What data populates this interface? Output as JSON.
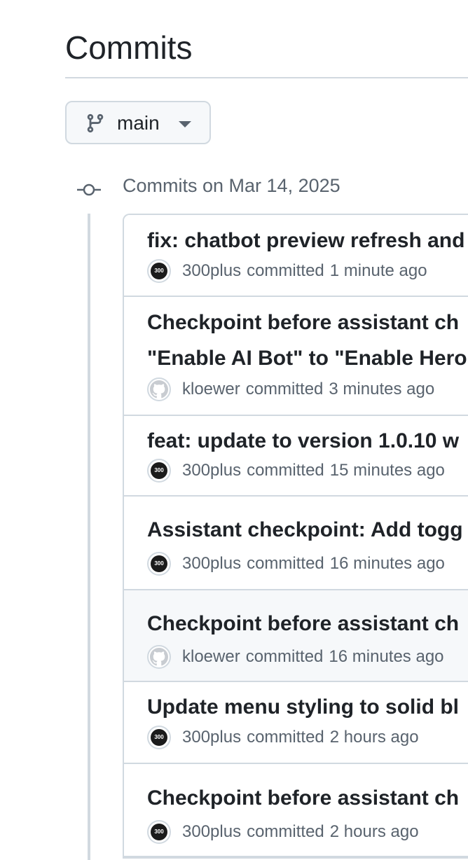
{
  "page": {
    "title": "Commits"
  },
  "branch": {
    "label": "main"
  },
  "group": {
    "date_label": "Commits on Mar 14, 2025"
  },
  "commits": [
    {
      "title": "fix: chatbot preview refresh and",
      "author": "300plus",
      "action": "committed",
      "time": "1 minute ago",
      "avatar": "300"
    },
    {
      "title": "Checkpoint before assistant ch",
      "title_line2": "\"Enable AI Bot\" to \"Enable Hero",
      "author": "kloewer",
      "action": "committed",
      "time": "3 minutes ago",
      "avatar": "github"
    },
    {
      "title": "feat: update to version 1.0.10 w",
      "author": "300plus",
      "action": "committed",
      "time": "15 minutes ago",
      "avatar": "300"
    },
    {
      "title": "Assistant checkpoint: Add togg",
      "author": "300plus",
      "action": "committed",
      "time": "16 minutes ago",
      "avatar": "300"
    },
    {
      "title": "Checkpoint before assistant ch",
      "author": "kloewer",
      "action": "committed",
      "time": "16 minutes ago",
      "avatar": "github"
    },
    {
      "title": "Update menu styling to solid bl",
      "author": "300plus",
      "action": "committed",
      "time": "2 hours ago",
      "avatar": "300"
    },
    {
      "title": "Checkpoint before assistant ch",
      "author": "300plus",
      "action": "committed",
      "time": "2 hours ago",
      "avatar": "300"
    }
  ],
  "avatar_text": "300",
  "icons": {
    "branch": "git-branch-icon",
    "caret": "caret-down-icon",
    "commit_node": "git-commit-icon"
  },
  "colors": {
    "text_primary": "#1f2328",
    "text_muted": "#59636e",
    "border": "#d1d9e0",
    "hover_bg": "#f6f8fa"
  }
}
